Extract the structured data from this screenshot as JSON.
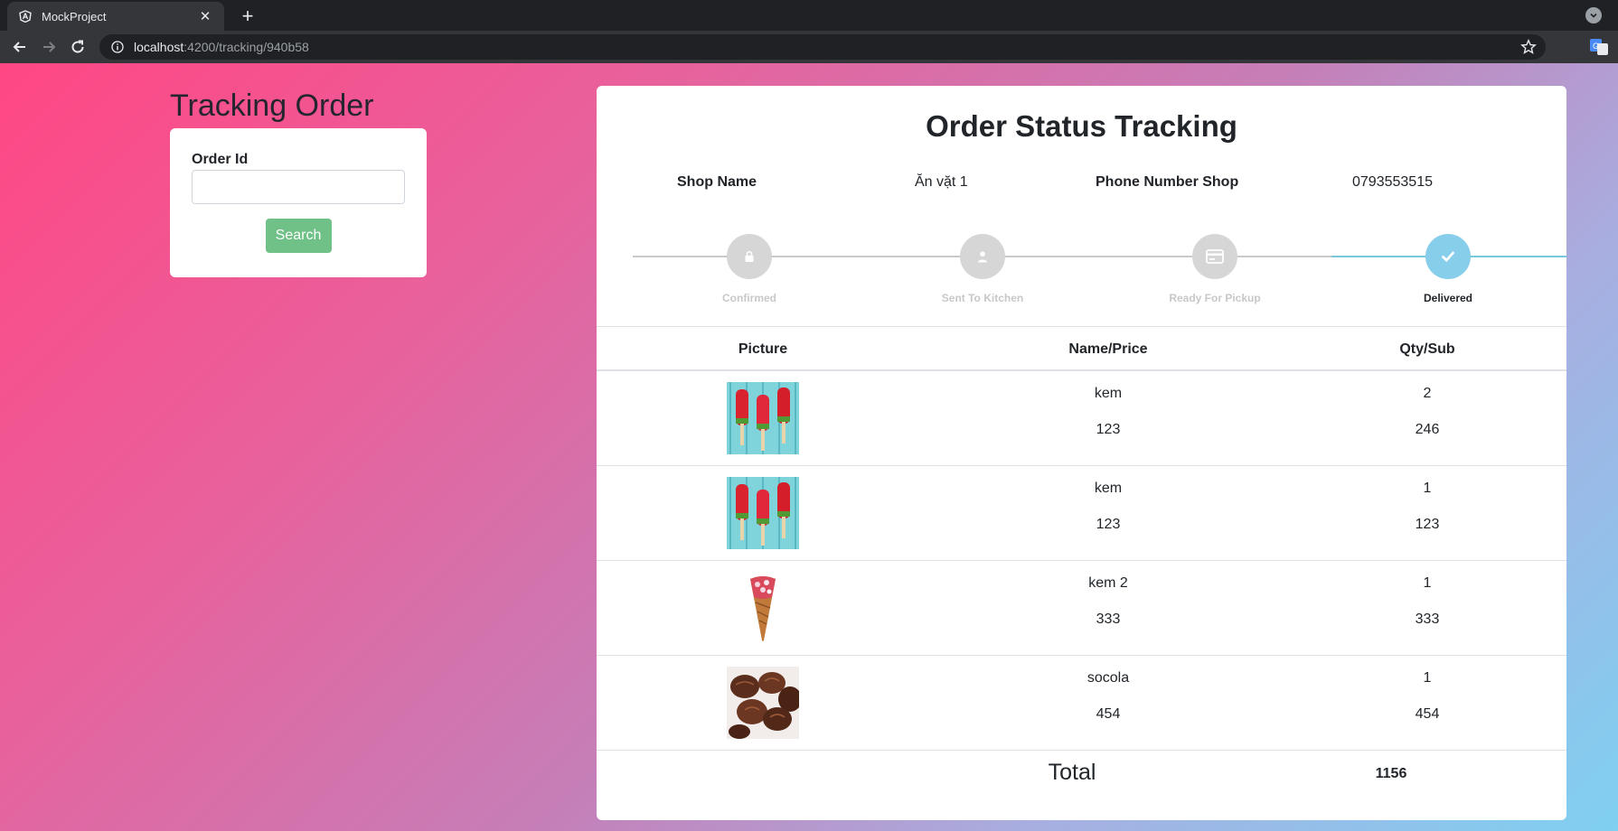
{
  "browser": {
    "tab_title": "MockProject",
    "url_host": "localhost",
    "url_path": ":4200/tracking/940b58",
    "colors": {
      "frame": "#202124",
      "toolbar": "#35363a"
    }
  },
  "left_panel": {
    "title": "Tracking Order",
    "order_id_label": "Order Id",
    "order_id_value": "",
    "search_label": "Search"
  },
  "tracking": {
    "title": "Order Status Tracking",
    "shop_name_label": "Shop Name",
    "shop_name_value": "Ăn vặt 1",
    "phone_label": "Phone Number Shop",
    "phone_value": "0793553515",
    "steps": [
      {
        "label": "Confirmed",
        "icon": "lock-icon",
        "active": false
      },
      {
        "label": "Sent To Kitchen",
        "icon": "person-icon",
        "active": false
      },
      {
        "label": "Ready For Pickup",
        "icon": "card-icon",
        "active": false
      },
      {
        "label": "Delivered",
        "icon": "check-icon",
        "active": true
      }
    ],
    "colors": {
      "inactive": "#d6d6d6",
      "active": "#87ceeb",
      "line": "#c9c9c9"
    }
  },
  "table": {
    "headers": [
      "Picture",
      "Name/Price",
      "Qty/Sub"
    ],
    "rows": [
      {
        "image": "popsicle-image",
        "name": "kem",
        "price": "123",
        "qty": "2",
        "sub": "246"
      },
      {
        "image": "popsicle-image",
        "name": "kem",
        "price": "123",
        "qty": "1",
        "sub": "123"
      },
      {
        "image": "cone-image",
        "name": "kem 2",
        "price": "333",
        "qty": "1",
        "sub": "333"
      },
      {
        "image": "chocolate-image",
        "name": "socola",
        "price": "454",
        "qty": "1",
        "sub": "454"
      }
    ],
    "total_label": "Total",
    "total_value": "1156"
  }
}
